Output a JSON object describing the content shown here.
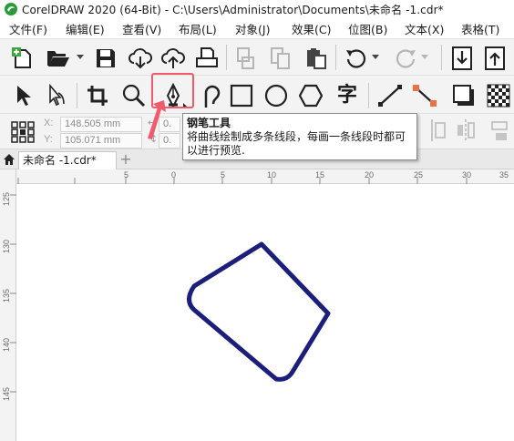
{
  "window": {
    "title": "CorelDRAW 2020 (64-Bit) - C:\\Users\\Administrator\\Documents\\未命名 -1.cdr*"
  },
  "menu": [
    {
      "label": "文件(F)"
    },
    {
      "label": "编辑(E)"
    },
    {
      "label": "查看(V)"
    },
    {
      "label": "布局(L)"
    },
    {
      "label": "对象(J)"
    },
    {
      "label": "效果(C)"
    },
    {
      "label": "位图(B)"
    },
    {
      "label": "文本(X)"
    },
    {
      "label": "表格(T)"
    }
  ],
  "toolbox": {
    "text_tool_glyph": "字",
    "active_tool": "pen-tool"
  },
  "property_bar": {
    "x_label": "X:",
    "y_label": "Y:",
    "x_value": "148.505 mm",
    "y_value": "105.071 mm",
    "w_partial": "0.",
    "h_partial": "0."
  },
  "tooltip": {
    "title": "钢笔工具",
    "description": "将曲线绘制成多条线段，每画一条线段时都可以进行预览."
  },
  "document_tab": {
    "label": "未命名 -1.cdr*",
    "add_symbol": "+"
  },
  "rulers": {
    "horizontal_ticks": [
      "5",
      "0",
      "5",
      "10",
      "15",
      "20",
      "25",
      "30",
      "35"
    ],
    "vertical_ticks": [
      "125",
      "130",
      "135",
      "140",
      "145"
    ]
  },
  "colors": {
    "shape_stroke": "#1c1f7a",
    "highlight": "#f05a6a",
    "ui_background": "#f3f3f3"
  }
}
